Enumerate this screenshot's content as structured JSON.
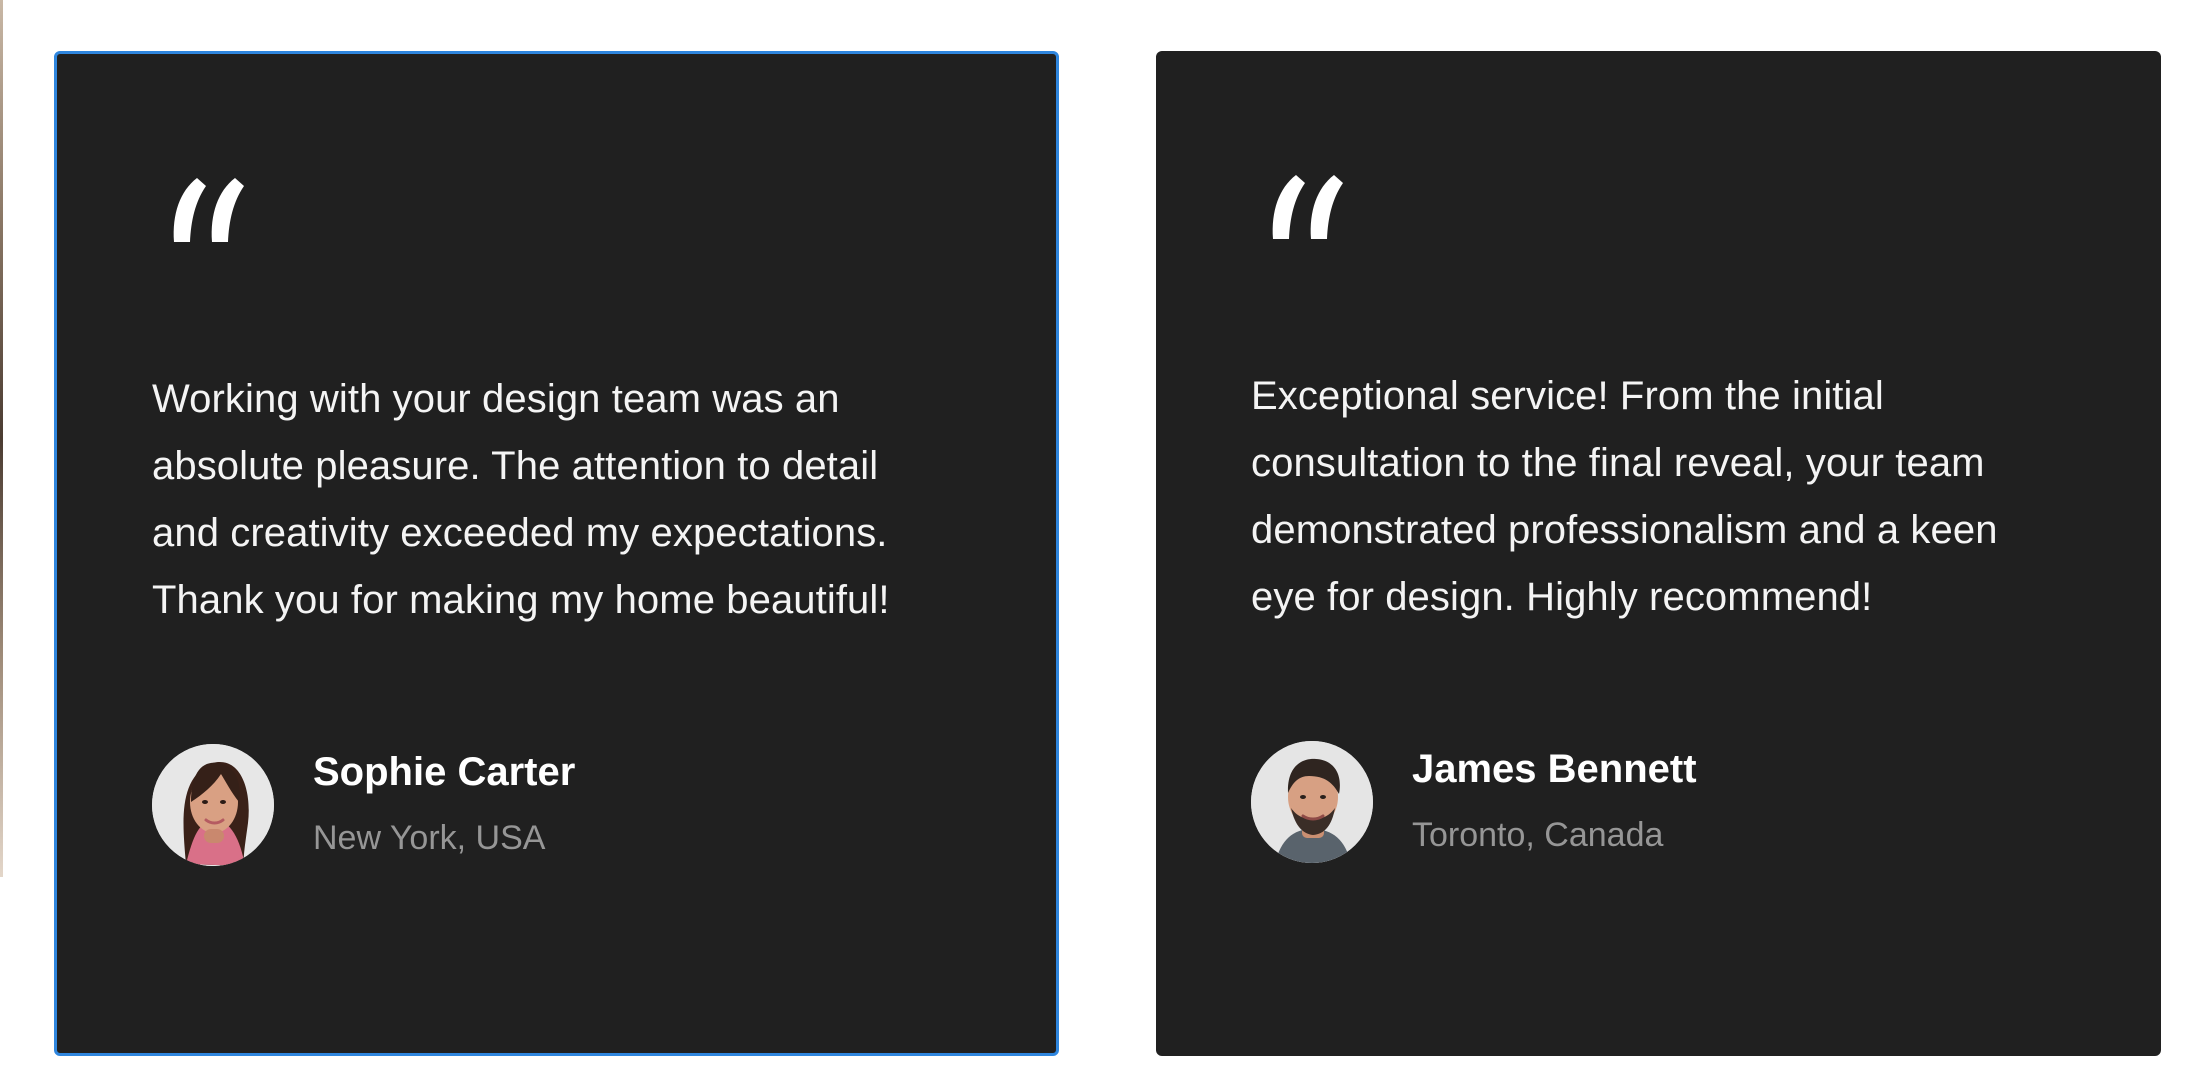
{
  "testimonials": [
    {
      "quote_icon": "quote-icon",
      "text": "Working with your design team was an\nabsolute pleasure. The attention to detail\nand creativity exceeded my expectations.\nThank you for making my home beautiful!",
      "name": "Sophie Carter",
      "location": "New York, USA",
      "avatar": "avatar-woman",
      "selected": true
    },
    {
      "quote_icon": "quote-icon",
      "text": "Exceptional service! From the initial\nconsultation to the final reveal, your team\ndemonstrated professionalism and a keen\neye for design. Highly recommend!",
      "name": "James Bennett",
      "location": "Toronto, Canada",
      "avatar": "avatar-man",
      "selected": false
    }
  ],
  "colors": {
    "page_background": "#ffffff",
    "card_background": "#202020",
    "selection_border": "#2f86de",
    "quote_text": "#f4f4f4",
    "author_name": "#ffffff",
    "author_location": "#969696"
  }
}
